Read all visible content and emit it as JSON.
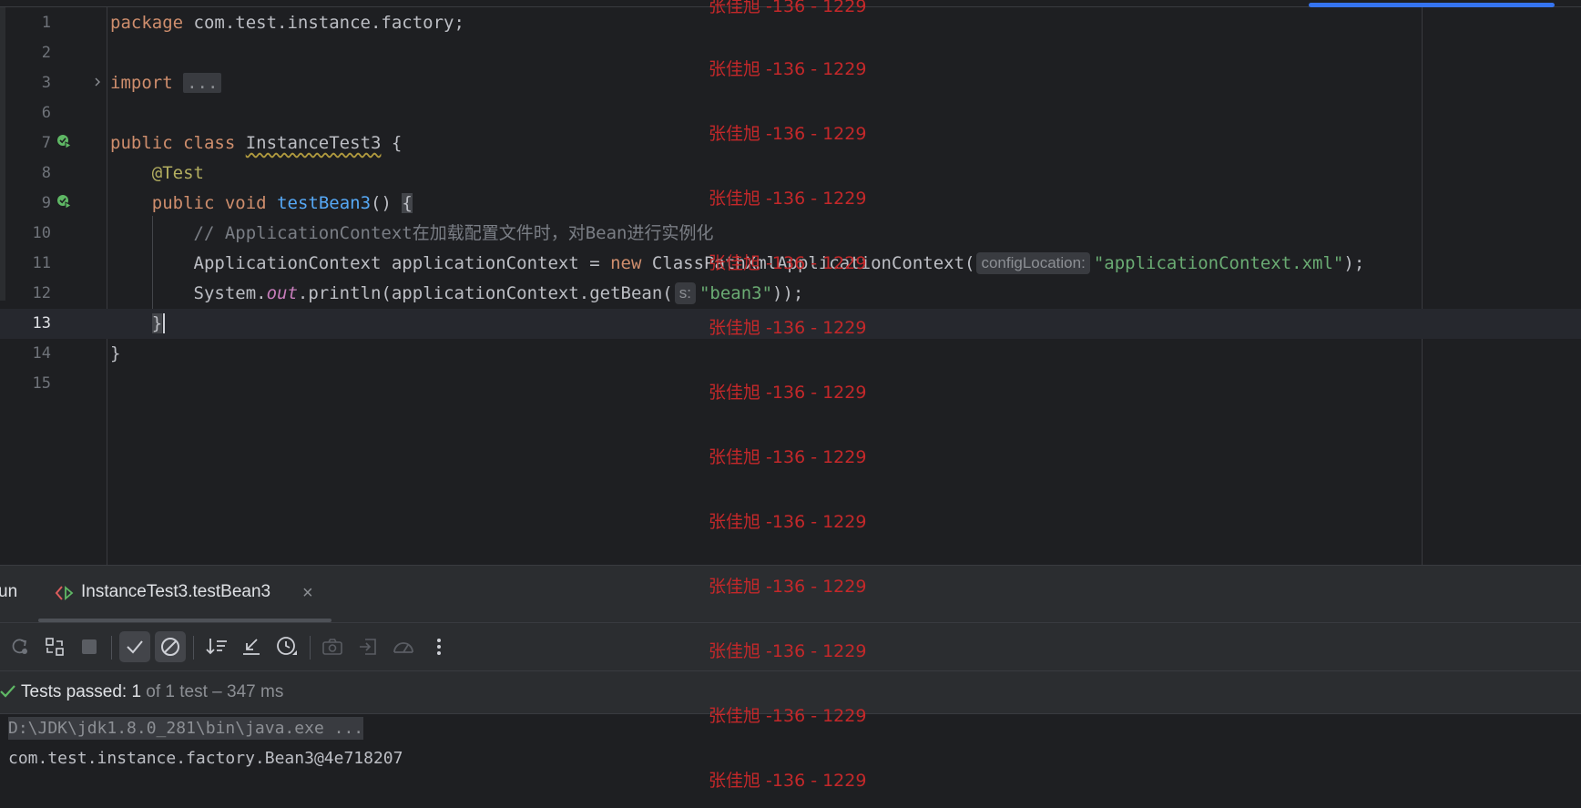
{
  "editor": {
    "lines": [
      {
        "n": "1"
      },
      {
        "n": "2"
      },
      {
        "n": "3"
      },
      {
        "n": "6"
      },
      {
        "n": "7"
      },
      {
        "n": "8"
      },
      {
        "n": "9"
      },
      {
        "n": "10"
      },
      {
        "n": "11"
      },
      {
        "n": "12"
      },
      {
        "n": "13"
      },
      {
        "n": "14"
      },
      {
        "n": "15"
      }
    ],
    "code": {
      "l1_kw": "package",
      "l1_rest": " com.test.instance.factory;",
      "l3_kw": "import",
      "l3_fold": "...",
      "l7_kw": "public class",
      "l7_class": "InstanceTest3",
      "l7_rest": " {",
      "l8_ann": "@Test",
      "l9_kw": "public void",
      "l9_fn": "testBean3",
      "l9_paren": "() ",
      "l9_brace": "{",
      "l10_comment": "// ApplicationContext在加载配置文件时，对Bean进行实例化",
      "l11_a": "ApplicationContext applicationContext = ",
      "l11_kw": "new",
      "l11_b": " ClassPathXmlApplicationContext(",
      "l11_hint": "configLocation:",
      "l11_str": "\"applicationContext.xml\"",
      "l11_end": ");",
      "l12_a": "System.",
      "l12_field": "out",
      "l12_b": ".println(applicationContext.getBean(",
      "l12_hint": "s:",
      "l12_str": "\"bean3\"",
      "l12_end": "));",
      "l13_brace": "}",
      "l14_brace": "}"
    }
  },
  "watermark": {
    "text": "张佳旭 -136 - 1229"
  },
  "run_panel": {
    "title": "un",
    "tab_label": "InstanceTest3.testBean3",
    "tab_close": "×",
    "status_label": "Tests passed: ",
    "status_count": "1",
    "status_detail": " of 1 test – 347 ms",
    "console": {
      "cmd": "D:\\JDK\\jdk1.8.0_281\\bin\\java.exe ...",
      "output": "com.test.instance.factory.Bean3@4e718207"
    }
  },
  "colors": {
    "background": "#1e1f22",
    "panel": "#2b2d30",
    "keyword": "#cf8e6d",
    "string": "#6aab73",
    "function": "#56a8f5",
    "annotation": "#b3ae60",
    "success": "#5fb865",
    "watermark": "#c4282a",
    "progress": "#3574f0"
  },
  "icons": {
    "gutter": [
      "run-test-icon",
      "fold-arrow-icon"
    ],
    "toolbar": [
      "rerun-icon",
      "rerun-failed-icon",
      "stop-icon",
      "show-passed-icon",
      "show-ignored-icon",
      "sort-icon",
      "collapse-icon",
      "history-icon",
      "screenshot-icon",
      "import-icon",
      "coverage-icon",
      "more-icon"
    ]
  }
}
